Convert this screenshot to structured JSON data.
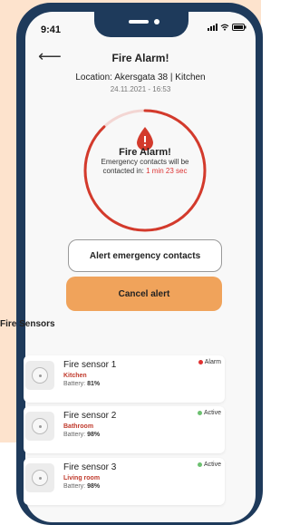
{
  "status_bar": {
    "time": "9:41"
  },
  "header": {
    "title": "Fire Alarm!"
  },
  "location": {
    "label": "Location: Akersgata 38 | Kitchen",
    "datetime": "24.11.2021 - 16:53"
  },
  "alarm": {
    "title": "Fire Alarm!",
    "subtitle_line1": "Emergency contacts will be",
    "subtitle_prefix": "contacted in:",
    "countdown": "1 min 23 sec",
    "progress": 0.88
  },
  "actions": {
    "alert_label": "Alert emergency contacts",
    "cancel_label": "Cancel alert"
  },
  "sensors": {
    "heading": "Fire Sensors",
    "items": [
      {
        "name": "Fire sensor 1",
        "room": "Kitchen",
        "battery_label": "Battery:",
        "battery": "81%",
        "status": "Alarm",
        "status_color": "#e03131"
      },
      {
        "name": "Fire sensor 2",
        "room": "Bathroom",
        "battery_label": "Battery:",
        "battery": "98%",
        "status": "Active",
        "status_color": "#6cc070"
      },
      {
        "name": "Fire sensor 3",
        "room": "Living room",
        "battery_label": "Battery:",
        "battery": "98%",
        "status": "Active",
        "status_color": "#6cc070"
      }
    ]
  },
  "colors": {
    "phone_frame": "#1e3a5b",
    "accent_red": "#d33a2c",
    "cancel_orange": "#f0a35b",
    "background_peach": "#fde3cd"
  }
}
